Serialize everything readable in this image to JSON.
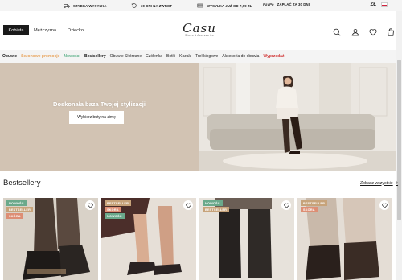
{
  "infobar": {
    "items": [
      {
        "label": "SZYBKA WYSYŁKA",
        "icon": "truck-icon"
      },
      {
        "label": "30 DNI NA ZWROT",
        "icon": "return-icon"
      },
      {
        "label": "WYSYŁKA JUŻ OD 7,99 ZŁ",
        "icon": "shipping-icon"
      },
      {
        "label": "ZAPŁAĆ ZA 30 DNI",
        "brand": "PayPo"
      }
    ],
    "language": "ZŁ"
  },
  "header": {
    "genders": [
      "Kobieta",
      "Mężczyzna",
      "Dziecko"
    ],
    "logo": {
      "word": "Casu",
      "sub": "Shoes & Accessories"
    },
    "icons": [
      "search-icon",
      "account-icon",
      "heart-icon",
      "cart-icon"
    ]
  },
  "nav": {
    "items": [
      {
        "label": "Obuwie",
        "color": "#1a1a1a"
      },
      {
        "label": "Sezonowe promocje",
        "color": "#e8a35b"
      },
      {
        "label": "Nowości",
        "color": "#5bb088"
      },
      {
        "label": "Bestsellery",
        "color": "#1a1a1a"
      },
      {
        "label": "Obuwie Skórzane",
        "color": "#222222"
      },
      {
        "label": "Czółenka",
        "color": "#222222"
      },
      {
        "label": "Botki",
        "color": "#222222"
      },
      {
        "label": "Kozaki",
        "color": "#222222"
      },
      {
        "label": "Trekkingowe",
        "color": "#222222"
      },
      {
        "label": "Akcesoria do obuwia",
        "color": "#222222"
      },
      {
        "label": "Wyprzedaż",
        "color": "#d23a3a"
      }
    ]
  },
  "hero": {
    "title": "Doskonała baza Twojej stylizacji",
    "button": "Wybierz buty na zimę",
    "bg_color": "#d2c3b3"
  },
  "bestsellers": {
    "title": "Bestsellery",
    "see_all": "Zobacz wszystkie",
    "products": [
      {
        "badges": [
          "NOWOŚĆ",
          "BESTSELLER",
          "SKÓRA"
        ]
      },
      {
        "badges": [
          "BESTSELLER",
          "SKÓRA",
          "NOWOŚĆ"
        ]
      },
      {
        "badges": [
          "NOWOŚĆ",
          "BESTSELLER"
        ]
      },
      {
        "badges": [
          "BESTSELLER",
          "SKÓRA"
        ]
      }
    ]
  },
  "colors": {
    "accent": "#1a1a1a",
    "nav_bg": "#f4f4f4",
    "badge_green": "#6aa98b",
    "badge_tan": "#c7a37a",
    "badge_salmon": "#dd8e74"
  }
}
